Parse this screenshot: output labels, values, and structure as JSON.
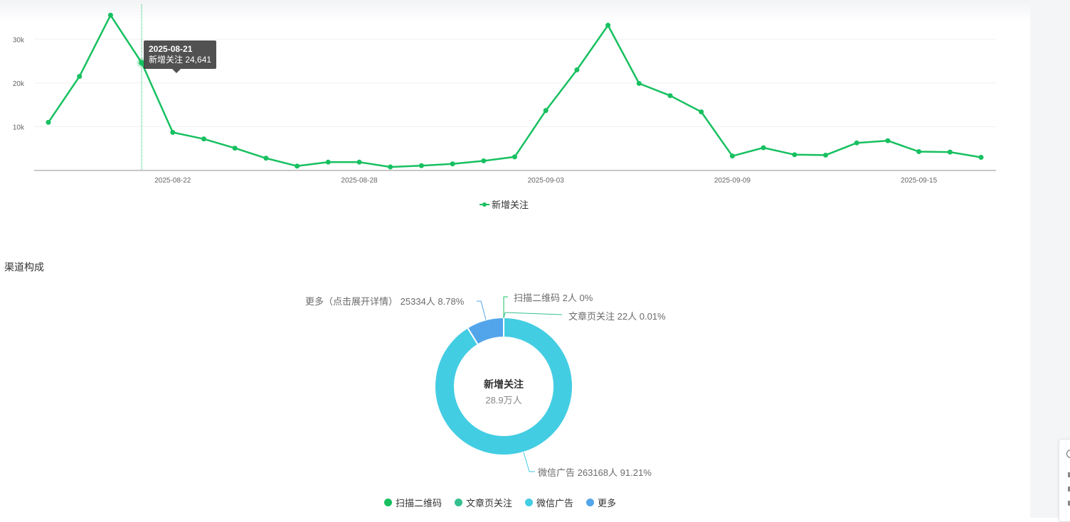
{
  "chart_data": [
    {
      "type": "line",
      "x": [
        "2025-08-18",
        "2025-08-19",
        "2025-08-20",
        "2025-08-21",
        "2025-08-22",
        "2025-08-23",
        "2025-08-24",
        "2025-08-25",
        "2025-08-26",
        "2025-08-27",
        "2025-08-28",
        "2025-08-29",
        "2025-08-30",
        "2025-08-31",
        "2025-09-01",
        "2025-09-02",
        "2025-09-03",
        "2025-09-04",
        "2025-09-05",
        "2025-09-06",
        "2025-09-07",
        "2025-09-08",
        "2025-09-09",
        "2025-09-10",
        "2025-09-11",
        "2025-09-12",
        "2025-09-13",
        "2025-09-14",
        "2025-09-15",
        "2025-09-16",
        "2025-09-17"
      ],
      "series": [
        {
          "name": "新增关注",
          "values": [
            11000,
            21500,
            35500,
            24641,
            8700,
            7200,
            5100,
            2800,
            1000,
            1900,
            1900,
            800,
            1100,
            1500,
            2200,
            3100,
            13700,
            23000,
            33200,
            19900,
            17100,
            13400,
            3300,
            5200,
            3600,
            3500,
            6300,
            6800,
            4300,
            4200,
            3000
          ]
        }
      ],
      "xticks": [
        "2025-08-22",
        "2025-08-28",
        "2025-09-03",
        "2025-09-09",
        "2025-09-15"
      ],
      "yticks": [
        "10k",
        "20k",
        "30k"
      ],
      "ylim": [
        0,
        38000
      ],
      "grid": true,
      "legend": "bottom-center",
      "tooltip": {
        "date": "2025-08-21",
        "label": "新增关注",
        "value": "24,641"
      }
    },
    {
      "type": "pie",
      "variant": "donut",
      "center_title": "新增关注",
      "center_value": "28.9万人",
      "slices": [
        {
          "name": "扫描二维码",
          "count": "2人",
          "percent": "0%",
          "value": 2,
          "color": "#17c060"
        },
        {
          "name": "文章页关注",
          "count": "22人",
          "percent": "0.01%",
          "value": 22,
          "color": "#36c08f"
        },
        {
          "name": "微信广告",
          "count": "263168人",
          "percent": "91.21%",
          "value": 263168,
          "color": "#43cde3"
        },
        {
          "name": "更多（点击展开详情）",
          "count": "25334人",
          "percent": "8.78%",
          "value": 25334,
          "color": "#52a5ea"
        }
      ],
      "legend_labels": [
        "扫描二维码",
        "文章页关注",
        "微信广告",
        "更多"
      ],
      "legend": "bottom-center"
    }
  ],
  "section": {
    "title": "渠道构成"
  },
  "colors": {
    "line": "#17c060",
    "text": "#333333",
    "axis": "#c8c8c8"
  }
}
